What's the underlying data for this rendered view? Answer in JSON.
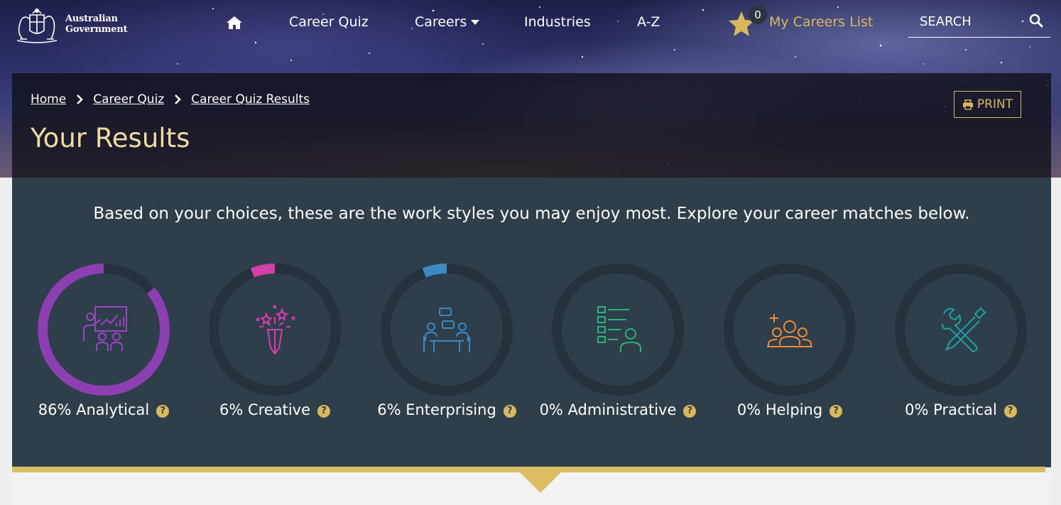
{
  "header": {
    "logo_text": "Australian Government",
    "nav": [
      "Career Quiz",
      "Careers",
      "Industries",
      "A-Z"
    ],
    "careers_list_count": "0",
    "careers_list_label": "My Careers List",
    "search_placeholder": "SEARCH"
  },
  "breadcrumb": [
    "Home",
    "Career Quiz",
    "Career Quiz Results"
  ],
  "page_title": "Your Results",
  "print_label": "PRINT",
  "intro": "Based on your choices, these are the work styles you may enjoy most. Explore your career matches below.",
  "work_styles": [
    {
      "label": "86% Analytical",
      "percent": 86,
      "color": "#8b3fb0",
      "icon": "analytical-presentation-icon"
    },
    {
      "label": "6% Creative",
      "percent": 6,
      "color": "#d63fa8",
      "icon": "creative-pencil-sparkle-icon"
    },
    {
      "label": "6% Enterprising",
      "percent": 6,
      "color": "#3b8ac4",
      "icon": "enterprising-meeting-icon"
    },
    {
      "label": "0% Administrative",
      "percent": 0,
      "color": "#29b27a",
      "icon": "administrative-checklist-icon"
    },
    {
      "label": "0% Helping",
      "percent": 0,
      "color": "#ef8b35",
      "icon": "helping-people-icon"
    },
    {
      "label": "0% Practical",
      "percent": 0,
      "color": "#1aa5a0",
      "icon": "practical-tools-icon"
    }
  ],
  "help_glyph": "?"
}
